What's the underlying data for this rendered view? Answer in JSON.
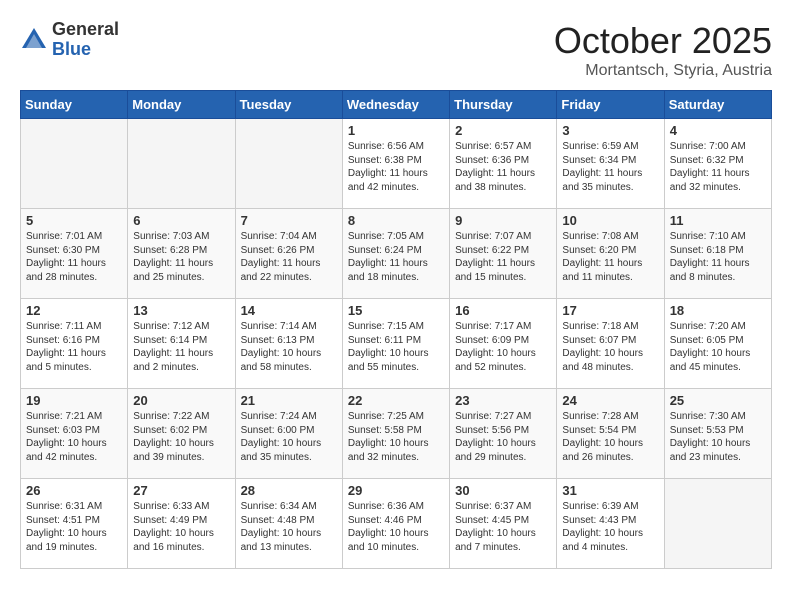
{
  "header": {
    "logo_general": "General",
    "logo_blue": "Blue",
    "month": "October 2025",
    "location": "Mortantsch, Styria, Austria"
  },
  "weekdays": [
    "Sunday",
    "Monday",
    "Tuesday",
    "Wednesday",
    "Thursday",
    "Friday",
    "Saturday"
  ],
  "weeks": [
    [
      {
        "day": "",
        "info": ""
      },
      {
        "day": "",
        "info": ""
      },
      {
        "day": "",
        "info": ""
      },
      {
        "day": "1",
        "info": "Sunrise: 6:56 AM\nSunset: 6:38 PM\nDaylight: 11 hours\nand 42 minutes."
      },
      {
        "day": "2",
        "info": "Sunrise: 6:57 AM\nSunset: 6:36 PM\nDaylight: 11 hours\nand 38 minutes."
      },
      {
        "day": "3",
        "info": "Sunrise: 6:59 AM\nSunset: 6:34 PM\nDaylight: 11 hours\nand 35 minutes."
      },
      {
        "day": "4",
        "info": "Sunrise: 7:00 AM\nSunset: 6:32 PM\nDaylight: 11 hours\nand 32 minutes."
      }
    ],
    [
      {
        "day": "5",
        "info": "Sunrise: 7:01 AM\nSunset: 6:30 PM\nDaylight: 11 hours\nand 28 minutes."
      },
      {
        "day": "6",
        "info": "Sunrise: 7:03 AM\nSunset: 6:28 PM\nDaylight: 11 hours\nand 25 minutes."
      },
      {
        "day": "7",
        "info": "Sunrise: 7:04 AM\nSunset: 6:26 PM\nDaylight: 11 hours\nand 22 minutes."
      },
      {
        "day": "8",
        "info": "Sunrise: 7:05 AM\nSunset: 6:24 PM\nDaylight: 11 hours\nand 18 minutes."
      },
      {
        "day": "9",
        "info": "Sunrise: 7:07 AM\nSunset: 6:22 PM\nDaylight: 11 hours\nand 15 minutes."
      },
      {
        "day": "10",
        "info": "Sunrise: 7:08 AM\nSunset: 6:20 PM\nDaylight: 11 hours\nand 11 minutes."
      },
      {
        "day": "11",
        "info": "Sunrise: 7:10 AM\nSunset: 6:18 PM\nDaylight: 11 hours\nand 8 minutes."
      }
    ],
    [
      {
        "day": "12",
        "info": "Sunrise: 7:11 AM\nSunset: 6:16 PM\nDaylight: 11 hours\nand 5 minutes."
      },
      {
        "day": "13",
        "info": "Sunrise: 7:12 AM\nSunset: 6:14 PM\nDaylight: 11 hours\nand 2 minutes."
      },
      {
        "day": "14",
        "info": "Sunrise: 7:14 AM\nSunset: 6:13 PM\nDaylight: 10 hours\nand 58 minutes."
      },
      {
        "day": "15",
        "info": "Sunrise: 7:15 AM\nSunset: 6:11 PM\nDaylight: 10 hours\nand 55 minutes."
      },
      {
        "day": "16",
        "info": "Sunrise: 7:17 AM\nSunset: 6:09 PM\nDaylight: 10 hours\nand 52 minutes."
      },
      {
        "day": "17",
        "info": "Sunrise: 7:18 AM\nSunset: 6:07 PM\nDaylight: 10 hours\nand 48 minutes."
      },
      {
        "day": "18",
        "info": "Sunrise: 7:20 AM\nSunset: 6:05 PM\nDaylight: 10 hours\nand 45 minutes."
      }
    ],
    [
      {
        "day": "19",
        "info": "Sunrise: 7:21 AM\nSunset: 6:03 PM\nDaylight: 10 hours\nand 42 minutes."
      },
      {
        "day": "20",
        "info": "Sunrise: 7:22 AM\nSunset: 6:02 PM\nDaylight: 10 hours\nand 39 minutes."
      },
      {
        "day": "21",
        "info": "Sunrise: 7:24 AM\nSunset: 6:00 PM\nDaylight: 10 hours\nand 35 minutes."
      },
      {
        "day": "22",
        "info": "Sunrise: 7:25 AM\nSunset: 5:58 PM\nDaylight: 10 hours\nand 32 minutes."
      },
      {
        "day": "23",
        "info": "Sunrise: 7:27 AM\nSunset: 5:56 PM\nDaylight: 10 hours\nand 29 minutes."
      },
      {
        "day": "24",
        "info": "Sunrise: 7:28 AM\nSunset: 5:54 PM\nDaylight: 10 hours\nand 26 minutes."
      },
      {
        "day": "25",
        "info": "Sunrise: 7:30 AM\nSunset: 5:53 PM\nDaylight: 10 hours\nand 23 minutes."
      }
    ],
    [
      {
        "day": "26",
        "info": "Sunrise: 6:31 AM\nSunset: 4:51 PM\nDaylight: 10 hours\nand 19 minutes."
      },
      {
        "day": "27",
        "info": "Sunrise: 6:33 AM\nSunset: 4:49 PM\nDaylight: 10 hours\nand 16 minutes."
      },
      {
        "day": "28",
        "info": "Sunrise: 6:34 AM\nSunset: 4:48 PM\nDaylight: 10 hours\nand 13 minutes."
      },
      {
        "day": "29",
        "info": "Sunrise: 6:36 AM\nSunset: 4:46 PM\nDaylight: 10 hours\nand 10 minutes."
      },
      {
        "day": "30",
        "info": "Sunrise: 6:37 AM\nSunset: 4:45 PM\nDaylight: 10 hours\nand 7 minutes."
      },
      {
        "day": "31",
        "info": "Sunrise: 6:39 AM\nSunset: 4:43 PM\nDaylight: 10 hours\nand 4 minutes."
      },
      {
        "day": "",
        "info": ""
      }
    ]
  ]
}
